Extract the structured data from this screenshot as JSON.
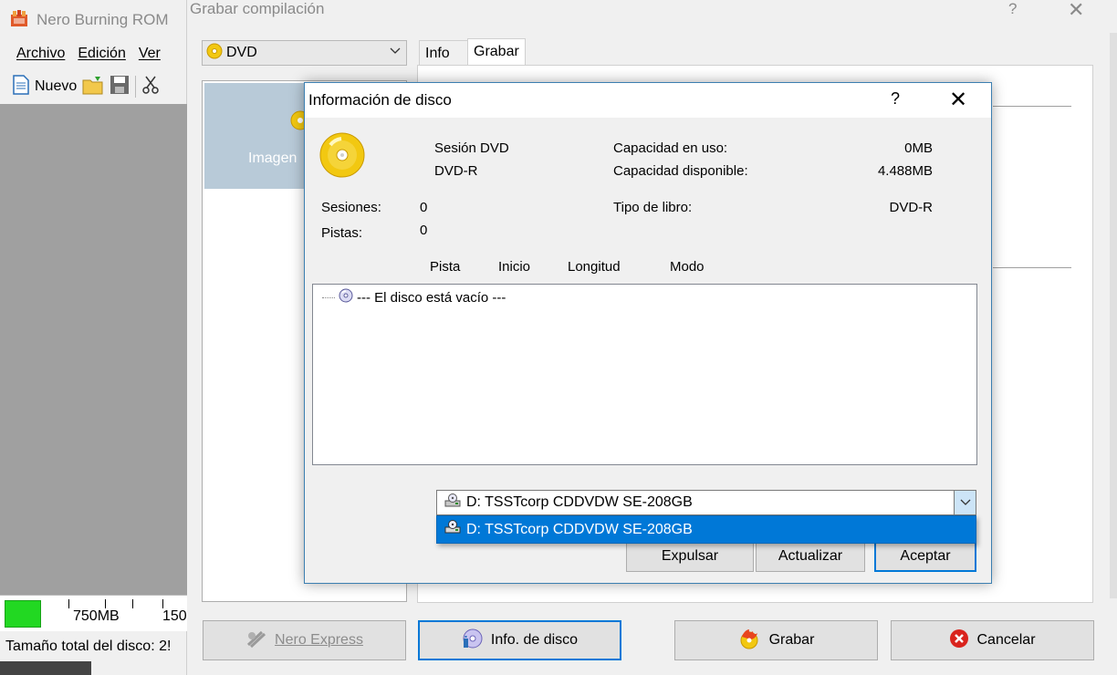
{
  "nero": {
    "title": "Nero Burning ROM",
    "menu": [
      "Archivo",
      "Edición",
      "Ver"
    ],
    "toolbar": {
      "new_label": "Nuevo"
    },
    "capacity": {
      "label1": "750MB",
      "label2": "150"
    },
    "status": "Tamaño total del disco: 2!"
  },
  "compilation": {
    "title": "Grabar compilación",
    "help": "?",
    "close": "✕",
    "disc_type": "DVD",
    "left_item_label": "Imagen",
    "tabs": [
      "Info",
      "Grabar"
    ],
    "active_tab": "Grabar",
    "buttons": {
      "nero_express": "Nero Express",
      "disc_info": "Info. de disco",
      "burn": "Grabar",
      "cancel": "Cancelar"
    }
  },
  "dialog": {
    "title": "Información de disco",
    "help": "?",
    "close": "✕",
    "session_type": "Sesión DVD",
    "media_type": "DVD-R",
    "used_label": "Capacidad en uso:",
    "used_value": "0MB",
    "available_label": "Capacidad disponible:",
    "available_value": "4.488MB",
    "sessions_label": "Sesiones:",
    "sessions_value": "0",
    "tracks_label": "Pistas:",
    "tracks_value": "0",
    "book_type_label": "Tipo de libro:",
    "book_type_value": "DVD-R",
    "columns": [
      "Pista",
      "Inicio",
      "Longitud",
      "Modo"
    ],
    "empty_item": "--- El disco está vacío ---",
    "drive_selected": "D: TSSTcorp CDDVDW SE-208GB",
    "drive_options": [
      "D: TSSTcorp CDDVDW SE-208GB"
    ],
    "buttons": {
      "eject": "Expulsar",
      "refresh": "Actualizar",
      "accept": "Aceptar"
    }
  },
  "colors": {
    "accent": "#0078d7",
    "disc_gold": "#f2c811",
    "capacity_green": "#22d822"
  }
}
